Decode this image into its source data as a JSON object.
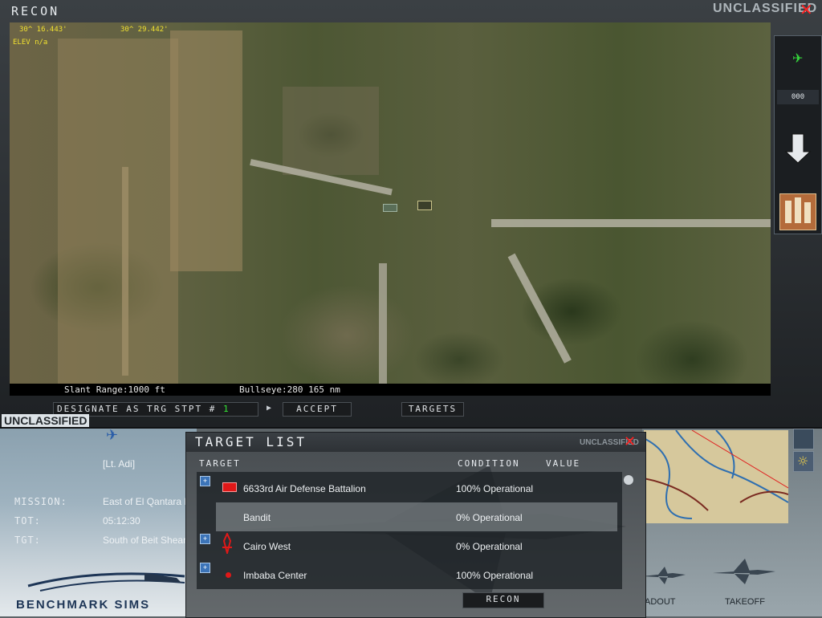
{
  "recon": {
    "title": "RECON",
    "classification": "UNCLASSIFIED",
    "close_icon": "close-icon",
    "coords": {
      "lat": "30^ 16.443'",
      "lon": "30^ 29.442'",
      "elev": "ELEV n/a"
    },
    "slant_range": "Slant Range:1000 ft",
    "bullseye": "Bullseye:280  165 nm",
    "zoom_value": "000",
    "designate_label": "DESIGNATE AS TRG STPT #",
    "stpt_number": "1",
    "accept_label": "ACCEPT",
    "targets_label": "TARGETS"
  },
  "left_panel": {
    "classification": "UNCLASSIFIED",
    "pilot": "[Lt. Adi]",
    "mission_label": "MISSION:",
    "mission_value": "East of El Qantara El",
    "tot_label": "TOT:",
    "tot_value": "05:12:30",
    "tgt_label": "TGT:",
    "tgt_value": "South of Beit Shean",
    "brand": "BENCHMARK SIMS"
  },
  "target_list": {
    "title": "TARGET LIST",
    "classification": "UNCLASSIFIED",
    "headers": {
      "target": "TARGET",
      "condition": "CONDITION",
      "value": "VALUE"
    },
    "rows": [
      {
        "name": "6633rd Air Defense Battalion",
        "condition": "100% Operational",
        "icon": "sam-site-icon",
        "expandable": true
      },
      {
        "name": "Bandit",
        "condition": "0% Operational",
        "icon": "",
        "expandable": false,
        "selected": true
      },
      {
        "name": "Cairo West",
        "condition": "0% Operational",
        "icon": "airbase-icon",
        "expandable": true
      },
      {
        "name": "Imbaba Center",
        "condition": "100% Operational",
        "icon": "target-dot-icon",
        "expandable": true
      }
    ],
    "recon_button": "RECON"
  },
  "bottom_right": {
    "loadout_label": "ADOUT",
    "takeoff_label": "TAKEOFF"
  },
  "colors": {
    "close": "#ff2020",
    "coord_text": "#f0e030",
    "stpt_green": "#35e835",
    "expand_blue": "#3c74b8"
  }
}
